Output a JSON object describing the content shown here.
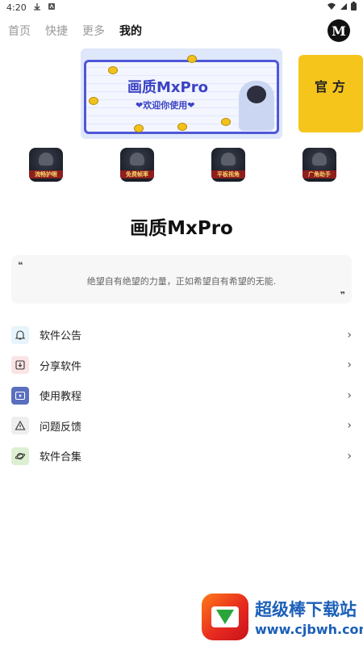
{
  "status_bar": {
    "time": "4:20"
  },
  "tabs": [
    {
      "label": "首页",
      "active": false
    },
    {
      "label": "快捷",
      "active": false
    },
    {
      "label": "更多",
      "active": false
    },
    {
      "label": "我的",
      "active": true
    }
  ],
  "logo_letter": "M",
  "banner": {
    "title": "画质MxPro",
    "subtitle": "❤欢迎你使用❤",
    "second_title": "官方"
  },
  "games": [
    {
      "caption": "流畅护眼"
    },
    {
      "caption": "免费帧率"
    },
    {
      "caption": "平板视角"
    },
    {
      "caption": "广角助手"
    }
  ],
  "app_title": "画质MxPro",
  "quote": {
    "open_mark": "❝",
    "close_mark": "❞",
    "text": "绝望自有绝望的力量，正如希望自有希望的无能."
  },
  "menu": [
    {
      "label": "软件公告",
      "icon": "bell-icon",
      "color": "#e6f4fb"
    },
    {
      "label": "分享软件",
      "icon": "share-box-icon",
      "color": "#fbe4e4"
    },
    {
      "label": "使用教程",
      "icon": "video-play-icon",
      "color": "#5b6fbf"
    },
    {
      "label": "问题反馈",
      "icon": "warning-icon",
      "color": "#eeeeee"
    },
    {
      "label": "软件合集",
      "icon": "planet-icon",
      "color": "#dcefd2"
    }
  ],
  "watermark": {
    "name": "超级棒下载站",
    "url": "www.cjbwh.com"
  },
  "colors": {
    "accent": "#4f57d8",
    "text": "#222222"
  }
}
